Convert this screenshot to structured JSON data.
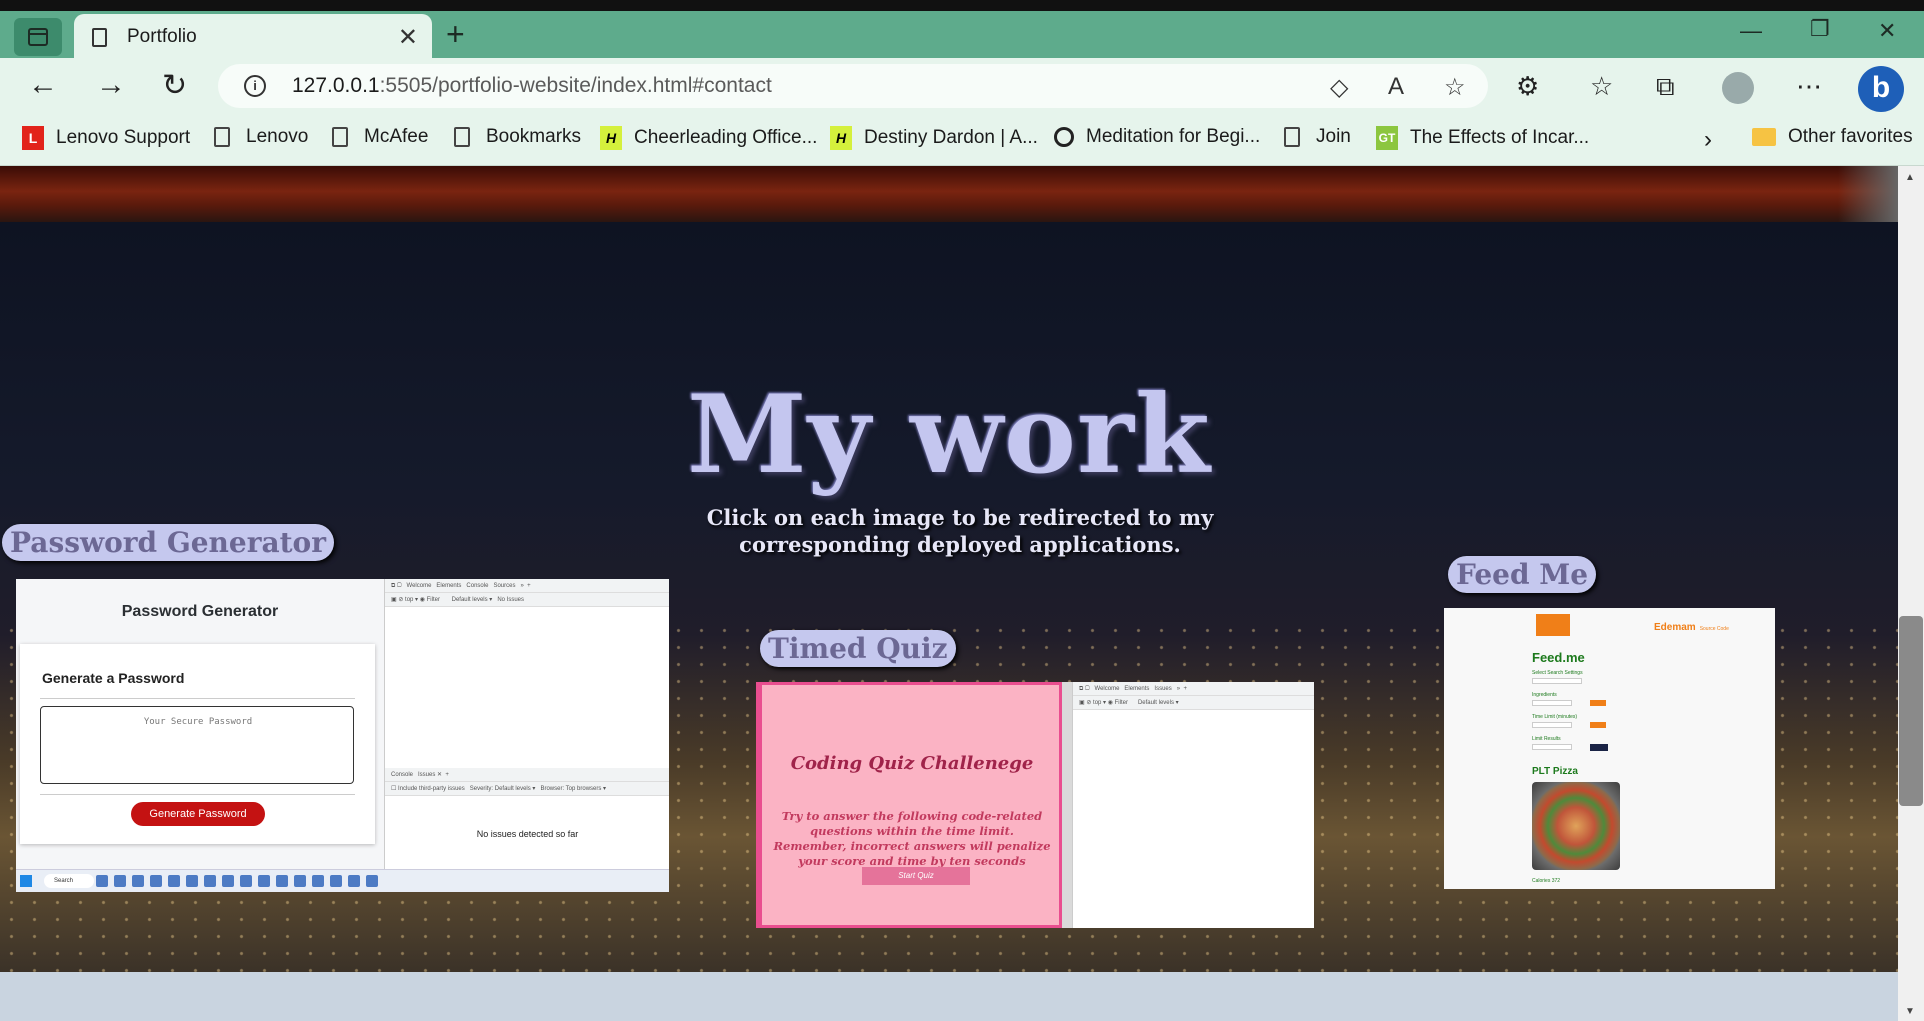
{
  "browser": {
    "tab_title": "Portfolio",
    "url_host": "127.0.0.1",
    "url_rest": ":5505/portfolio-website/index.html#contact",
    "bookmarks": [
      {
        "label": "Lenovo Support",
        "icon": "lenovo-icon"
      },
      {
        "label": "Lenovo",
        "icon": "page-icon"
      },
      {
        "label": "McAfee",
        "icon": "page-icon"
      },
      {
        "label": "Bookmarks",
        "icon": "page-icon"
      },
      {
        "label": "Cheerleading Office...",
        "icon": "hy-icon"
      },
      {
        "label": "Destiny Dardon | A...",
        "icon": "hy-icon"
      },
      {
        "label": "Meditation for Begi...",
        "icon": "ring-icon"
      },
      {
        "label": "Join",
        "icon": "page-icon"
      },
      {
        "label": "The Effects of Incar...",
        "icon": "gt-icon"
      }
    ],
    "other_favorites": "Other favorites"
  },
  "section": {
    "title": "My work",
    "subtitle": "Click on each image to be redirected to my corresponding deployed applications."
  },
  "projects": {
    "password": {
      "label": "Password Generator",
      "app_title": "Password Generator",
      "card_heading": "Generate a Password",
      "placeholder": "Your Secure Password",
      "button": "Generate Password",
      "devtools_status": "No issues detected so far",
      "taskbar_search": "Search"
    },
    "quiz": {
      "label": "Timed Quiz",
      "title": "Coding Quiz Challenege",
      "description": "Try to answer the following code-related questions within the time limit. Remember, incorrect answers will penalize your score and time by ten seconds",
      "button": "Start Quiz"
    },
    "feedme": {
      "label": "Feed Me",
      "brand": "Edemam",
      "brand_sub": "Source Code",
      "title": "Feed.me",
      "settings": "Select Search Settings",
      "ingredients": "Ingredients",
      "time_limit": "Time Limit (minutes)",
      "limit_results": "Limit Results",
      "recipe": "PLT Pizza",
      "calories": "Calories 372"
    }
  },
  "colors": {
    "chrome": "#5eab8c",
    "toolbar": "#e6f4ec",
    "heading": "#c4c6ef",
    "pill": "#c5c8ee",
    "quiz_pink": "#fbb3c4",
    "generate_red": "#c41212"
  }
}
